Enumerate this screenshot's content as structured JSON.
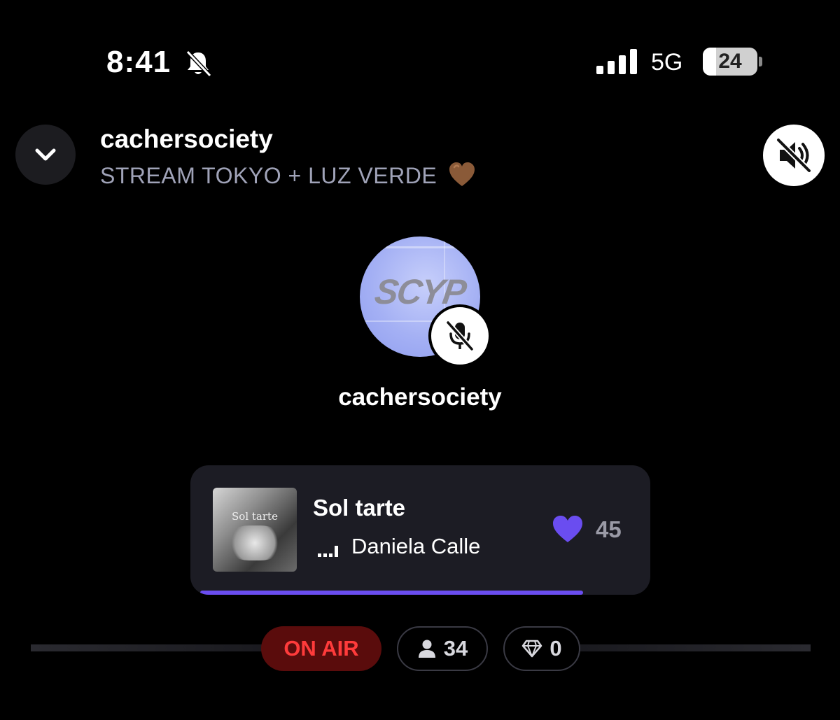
{
  "status_bar": {
    "time": "8:41",
    "network": "5G",
    "battery": "24",
    "battery_level": 0.24
  },
  "header": {
    "host": "cachersociety",
    "room_title": "STREAM TOKYO + LUZ VERDE",
    "title_emoji": "brown-heart"
  },
  "speaker": {
    "name": "cachersociety",
    "avatar_text": "SCYP",
    "mic_state": "muted"
  },
  "now_playing": {
    "title": "Sol tarte",
    "artist": "Daniela Calle",
    "album_art_text": "Sol tarte",
    "likes": "45",
    "progress": 0.87
  },
  "room_stats": {
    "live_label": "ON AIR",
    "listeners": "34",
    "gems": "0"
  },
  "colors": {
    "accent": "#6a4df0",
    "live_red": "#ff3b3b",
    "live_bg": "#5a0c0c",
    "subtitle": "#a0a3b8"
  }
}
